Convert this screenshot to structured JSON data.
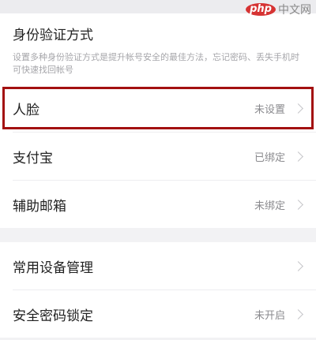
{
  "watermark": {
    "logo": "php",
    "text": "中文网"
  },
  "auth_section": {
    "title": "身份验证方式",
    "description": "设置多种身份验证方式是提升帐号安全的最佳方法，忘记密码、丢失手机时可快速找回帐号",
    "items": [
      {
        "label": "人脸",
        "status": "未设置",
        "highlight_color": "#a31010"
      },
      {
        "label": "支付宝",
        "status": "已绑定"
      },
      {
        "label": "辅助邮箱",
        "status": "未绑定"
      }
    ]
  },
  "device_section": {
    "items": [
      {
        "label": "常用设备管理",
        "status": ""
      },
      {
        "label": "安全密码锁定",
        "status": "未开启"
      }
    ]
  }
}
